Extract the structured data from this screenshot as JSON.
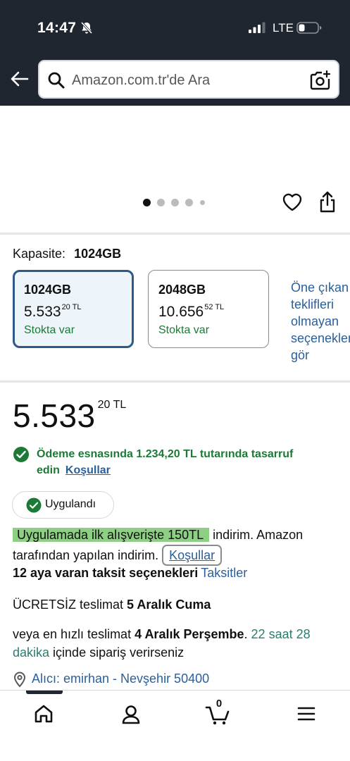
{
  "status_bar": {
    "time": "14:47",
    "network": "LTE"
  },
  "search": {
    "placeholder": "Amazon.com.tr'de Ara"
  },
  "carousel": {
    "dot_count": 5,
    "active_index": 0
  },
  "capacity": {
    "label": "Kapasite:",
    "selected": "1024GB",
    "options": [
      {
        "size": "1024GB",
        "price_main": "5.533",
        "price_fraction": "20 TL",
        "stock": "Stokta var"
      },
      {
        "size": "2048GB",
        "price_main": "10.656",
        "price_fraction": "52 TL",
        "stock": "Stokta var"
      }
    ],
    "more_offers": [
      "Öne çıkan",
      "teklifleri",
      "olmayan",
      "seçenekleri",
      "gör"
    ]
  },
  "price": {
    "main": "5.533",
    "fraction": "20 TL"
  },
  "savings": {
    "text": "Ödeme esnasında 1.234,20 TL tutarında tasarruf edin",
    "link": "Koşullar"
  },
  "applied_badge": "Uygulandı",
  "promo": {
    "highlight": "Uygulamada ilk alışverişte 150TL",
    "rest": " indirim. Amazon tarafından yapılan indirim.",
    "link": "Koşullar"
  },
  "installments": {
    "text": "12 aya varan taksit seçenekleri",
    "link": "Taksitler"
  },
  "delivery": {
    "free_label": "ÜCRETSİZ teslimat",
    "free_date": "5 Aralık Cuma",
    "fast_prefix": "veya en hızlı teslimat",
    "fast_date": "4 Aralık Perşembe",
    "countdown": "22 saat 28 dakika",
    "fast_suffix": "içinde sipariş verirseniz"
  },
  "address": "Alıcı: emirhan - Nevşehir 50400",
  "bottom_nav": {
    "cart_count": "0",
    "items": [
      "home-icon",
      "account-icon",
      "cart-icon",
      "menu-icon"
    ]
  },
  "colors": {
    "header_bg": "#1f2630",
    "link": "#2a5f9a",
    "in_stock": "#1c7a36",
    "highlight": "#8ed083"
  }
}
